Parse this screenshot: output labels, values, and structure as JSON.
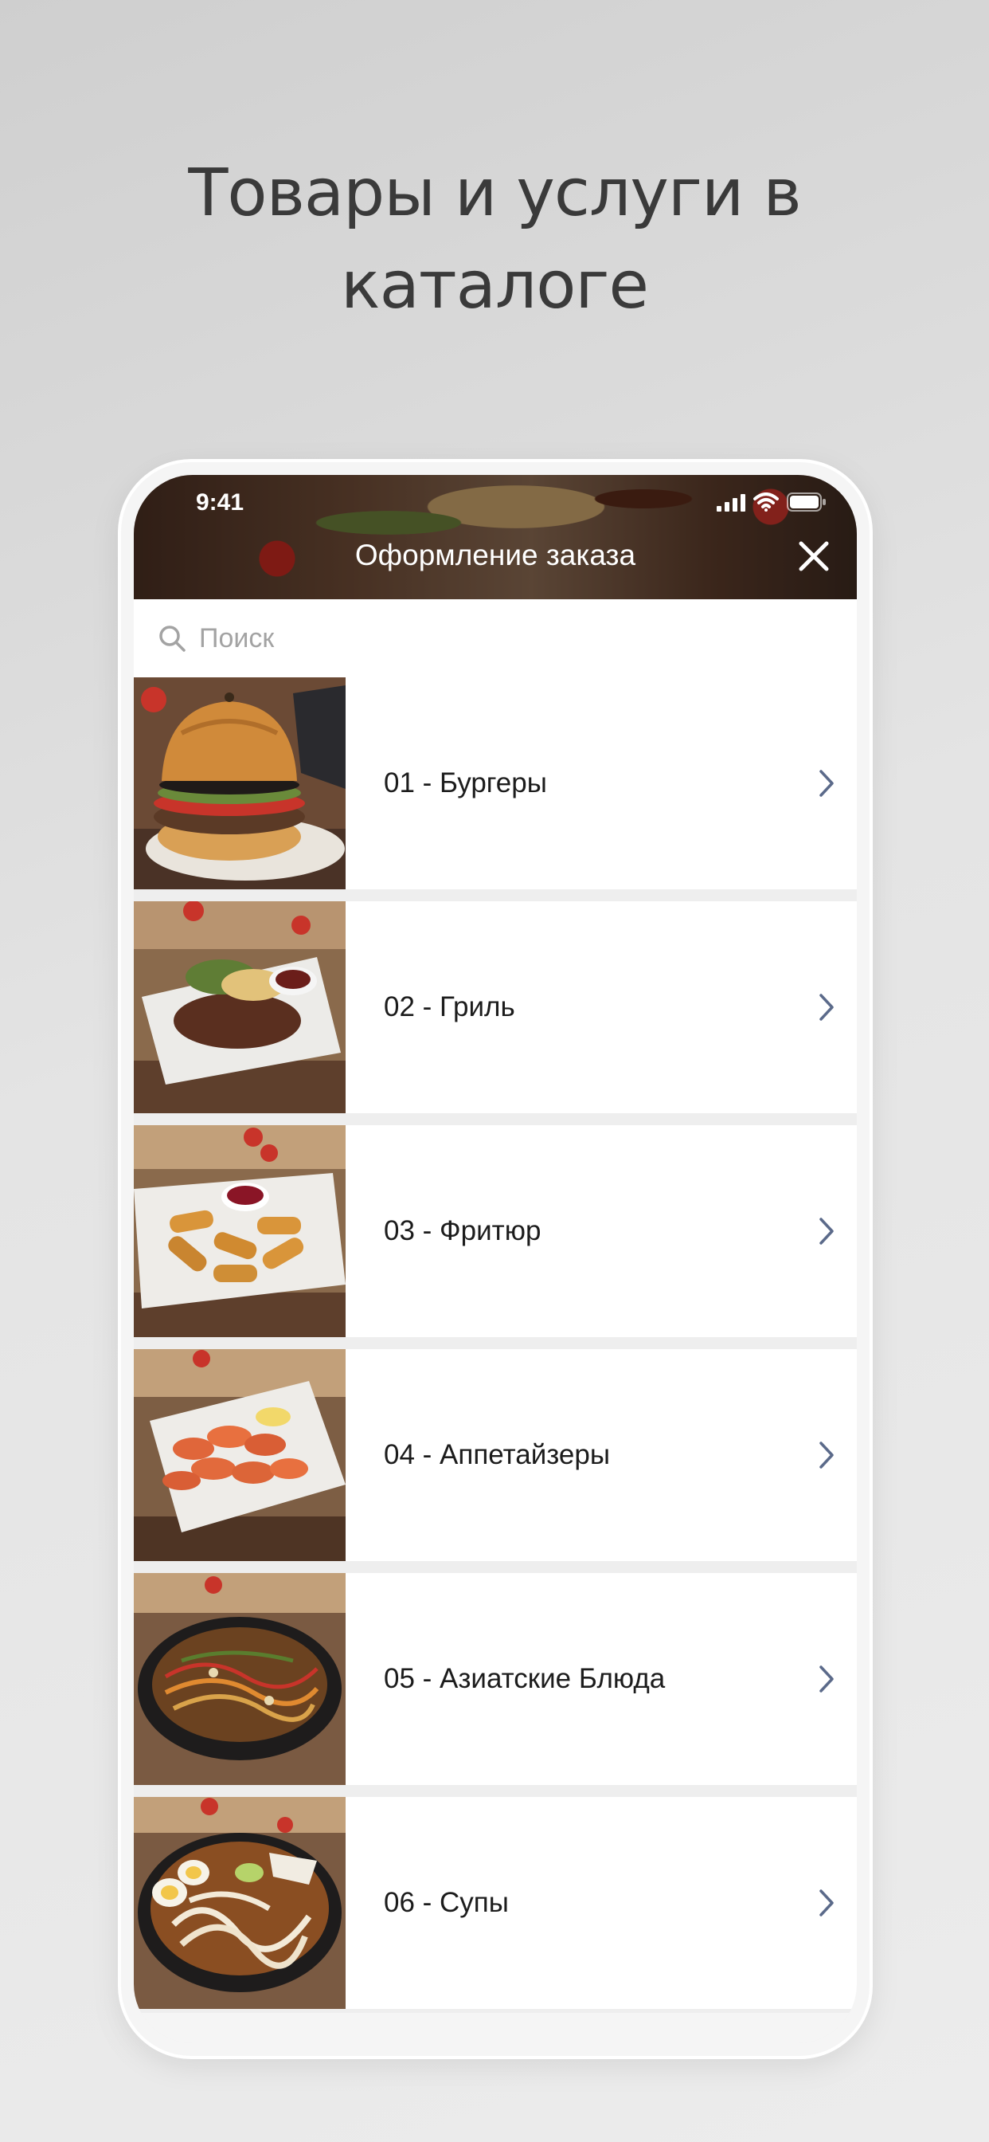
{
  "promo": {
    "headline_line1": "Товары и услуги в",
    "headline_line2": "каталоге"
  },
  "status_bar": {
    "time": "9:41",
    "icons": [
      "signal-icon",
      "wifi-icon",
      "battery-icon"
    ]
  },
  "header": {
    "title": "Оформление заказа",
    "close_icon": "close-icon"
  },
  "search": {
    "placeholder": "Поиск",
    "icon": "search-icon"
  },
  "categories": [
    {
      "label": "01 - Бургеры",
      "image": "burger"
    },
    {
      "label": "02 - Гриль",
      "image": "grill"
    },
    {
      "label": "03 - Фритюр",
      "image": "fried-sticks"
    },
    {
      "label": "04 - Аппетайзеры",
      "image": "shrimp"
    },
    {
      "label": "05 - Азиатские Блюда",
      "image": "asian-noodles"
    },
    {
      "label": "06 - Супы",
      "image": "soup"
    }
  ],
  "colors": {
    "accent_red": "#c8342a",
    "chevron": "#5b6a8a",
    "headline": "#3a3a3a"
  }
}
